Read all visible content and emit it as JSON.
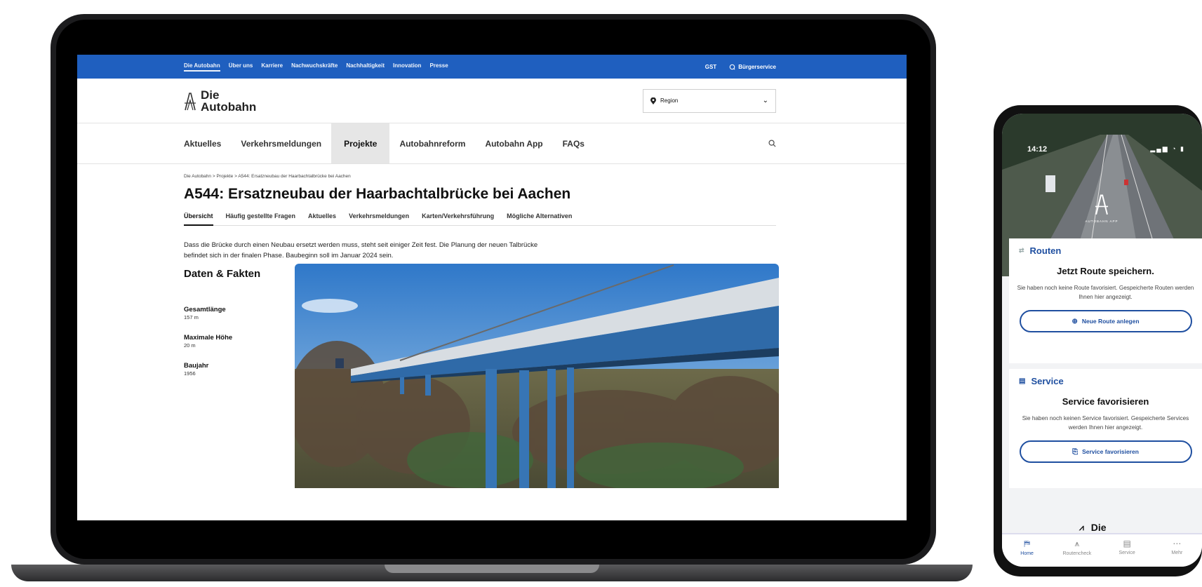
{
  "website": {
    "topbar": {
      "links": [
        "Die Autobahn",
        "Über uns",
        "Karriere",
        "Nachwuchskräfte",
        "Nachhaltigkeit",
        "Innovation",
        "Presse"
      ],
      "gst": "GST",
      "buergerservice": "Bürgerservice"
    },
    "logo": {
      "line1": "Die",
      "line2": "Autobahn"
    },
    "region": {
      "label": "Region"
    },
    "nav": [
      "Aktuelles",
      "Verkehrsmeldungen",
      "Projekte",
      "Autobahnreform",
      "Autobahn App",
      "FAQs"
    ],
    "breadcrumb": "Die Autobahn  >  Projekte  >  A544: Ersatzneubau der Haarbachtalbrücke bei Aachen",
    "title": "A544: Ersatzneubau der Haarbachtalbrücke bei Aachen",
    "subtabs": [
      "Übersicht",
      "Häufig gestellte Fragen",
      "Aktuelles",
      "Verkehrsmeldungen",
      "Karten/Verkehrsführung",
      "Mögliche Alternativen"
    ],
    "intro": "Dass die Brücke durch einen Neubau ersetzt werden muss, steht seit einiger Zeit fest. Die Planung der neuen Talbrücke befindet sich in der finalen Phase. Baubeginn soll im Januar 2024 sein.",
    "facts": {
      "title": "Daten & Fakten",
      "items": [
        {
          "label": "Gesamtlänge",
          "value": "157 m"
        },
        {
          "label": "Maximale Höhe",
          "value": "20 m"
        },
        {
          "label": "Baujahr",
          "value": "1956"
        }
      ]
    }
  },
  "phone": {
    "time": "14:12",
    "status": "▂▄▆ ◔ ▮",
    "app_logo_text": "AUTOBAHN APP",
    "routes": {
      "section": "Routen",
      "heading": "Jetzt Route speichern.",
      "description": "Sie haben noch keine Route favorisiert. Gespeicherte Routen werden Ihnen hier angezeigt.",
      "button": "Neue Route anlegen"
    },
    "service": {
      "section": "Service",
      "heading": "Service favorisieren",
      "description": "Sie haben noch keinen Service favorisiert. Gespeicherte Services werden Ihnen hier angezeigt.",
      "button": "Service favorisieren"
    },
    "logo_peek": "Die",
    "tabs": [
      {
        "label": "Home",
        "icon": "map-icon"
      },
      {
        "label": "Routencheck",
        "icon": "road-icon"
      },
      {
        "label": "Service",
        "icon": "document-icon"
      },
      {
        "label": "Mehr",
        "icon": "more-icon"
      }
    ]
  },
  "colors": {
    "brand_blue": "#1f5fbf",
    "app_blue": "#1f4fa0"
  }
}
